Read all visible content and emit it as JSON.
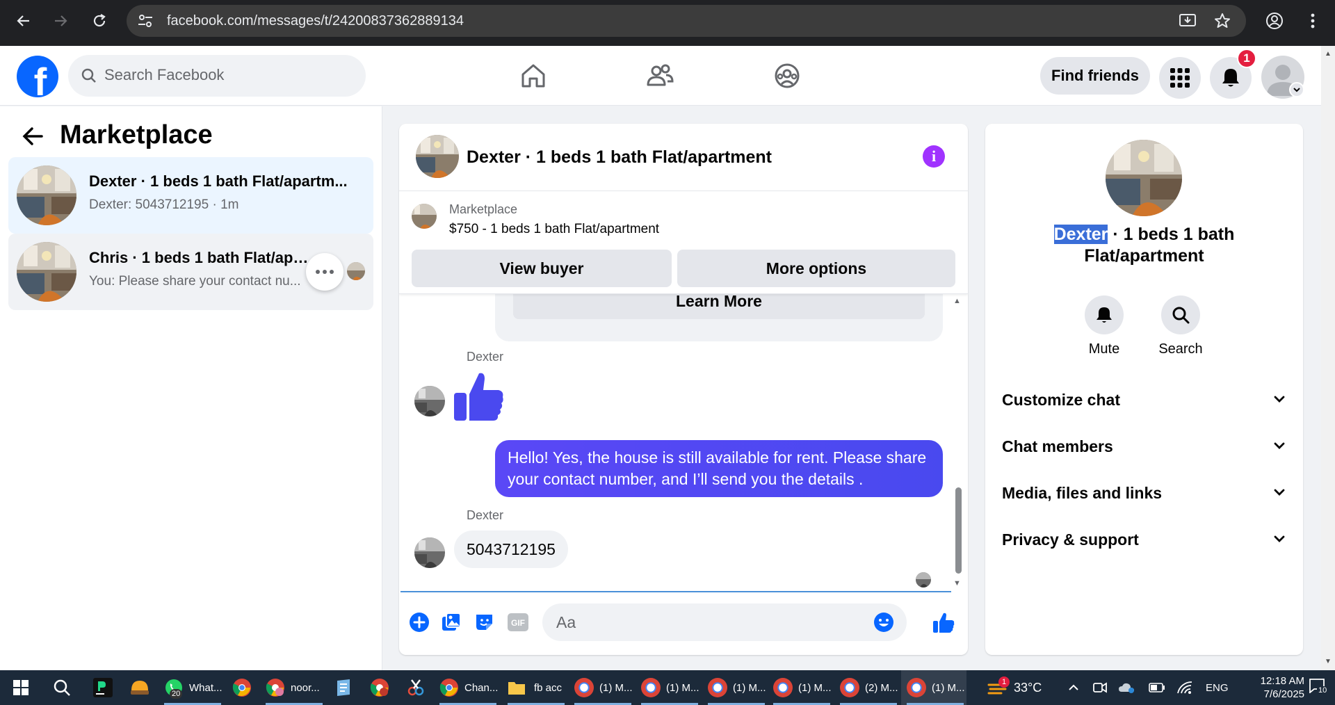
{
  "browser": {
    "url": "facebook.com/messages/t/24200837362889134"
  },
  "fb_header": {
    "search_placeholder": "Search Facebook",
    "find_friends_label": "Find friends",
    "notification_count": "1"
  },
  "sidebar": {
    "title": "Marketplace",
    "conversations": [
      {
        "name": "Dexter · 1 beds 1 bath Flat/apartm...",
        "preview": "Dexter: 5043712195 · 1m"
      },
      {
        "name": "Chris · 1 beds 1 bath Flat/apartm...",
        "preview": "You: Please share your contact nu..."
      }
    ]
  },
  "chat": {
    "title": "Dexter · 1 beds 1 bath Flat/apartment",
    "listing": {
      "source": "Marketplace",
      "price_title": "$750 - 1 beds 1 bath Flat/apartment",
      "view_buyer_label": "View buyer",
      "more_options_label": "More options"
    },
    "learn_more_label": "Learn More",
    "messages": [
      {
        "sender": "Dexter",
        "type": "like"
      },
      {
        "sender": "You",
        "text": "Hello! Yes, the house is still available for rent. Please share your contact number, and I’ll send you the details ."
      },
      {
        "sender": "Dexter",
        "text": "5043712195"
      }
    ],
    "input_placeholder": "Aa",
    "gif_label": "GIF"
  },
  "details": {
    "name_highlight": "Dexter",
    "name_rest": " · 1 beds 1 bath Flat/apartment",
    "actions": [
      {
        "label": "Mute",
        "icon": "bell-icon"
      },
      {
        "label": "Search",
        "icon": "search-icon"
      }
    ],
    "sections": [
      "Customize chat",
      "Chat members",
      "Media, files and links",
      "Privacy & support"
    ]
  },
  "taskbar": {
    "apps": [
      {
        "label": "What...",
        "badge": "20"
      },
      {
        "label": "noor..."
      },
      {
        "label": "Chan..."
      },
      {
        "label": "fb acc"
      },
      {
        "label": "(1) M..."
      },
      {
        "label": "(1) M..."
      },
      {
        "label": "(1) M..."
      },
      {
        "label": "(1) M..."
      },
      {
        "label": "(2) M..."
      },
      {
        "label": "(1) M..."
      }
    ],
    "weather": "33°C",
    "weather_badge": "1",
    "language": "ENG",
    "time": "12:18 AM",
    "date": "7/6/2025",
    "notification_count": "10"
  },
  "colors": {
    "fb_blue": "#0866ff",
    "messenger_purple": "#4f46e5",
    "info_purple": "#a033ff",
    "notification_red": "#e41e3f"
  }
}
